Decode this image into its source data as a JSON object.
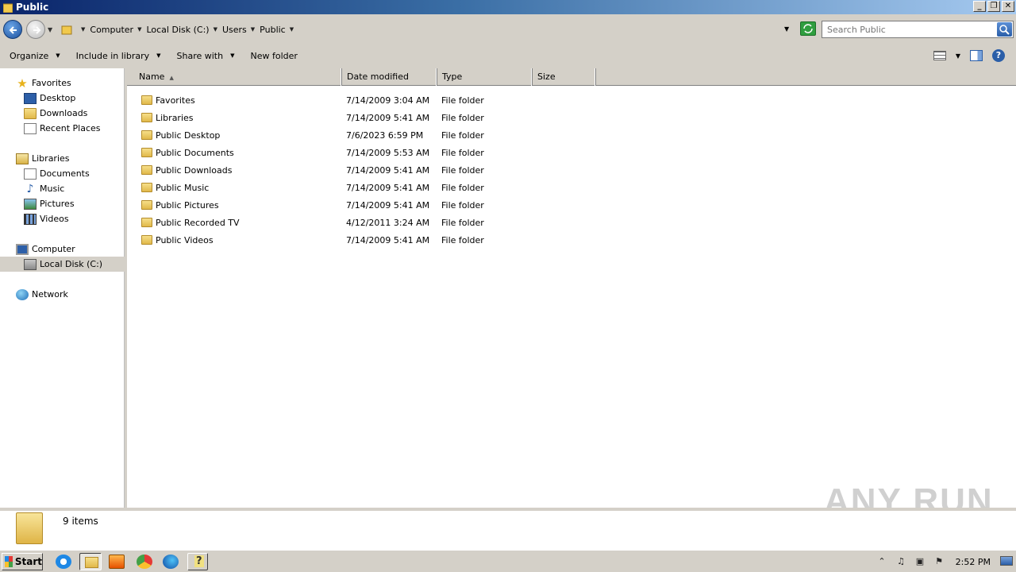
{
  "window": {
    "title": "Public"
  },
  "address": {
    "crumbs": [
      "Computer",
      "Local Disk (C:)",
      "Users",
      "Public"
    ]
  },
  "search": {
    "placeholder": "Search Public"
  },
  "toolbar": {
    "organize": "Organize",
    "include_in_library": "Include in library",
    "share_with": "Share with",
    "new_folder": "New folder"
  },
  "nav": {
    "favorites": "Favorites",
    "desktop": "Desktop",
    "downloads": "Downloads",
    "recent_places": "Recent Places",
    "libraries": "Libraries",
    "documents": "Documents",
    "music": "Music",
    "pictures": "Pictures",
    "videos": "Videos",
    "computer": "Computer",
    "local_disk": "Local Disk (C:)",
    "network": "Network"
  },
  "columns": {
    "name": "Name",
    "date_modified": "Date modified",
    "type": "Type",
    "size": "Size"
  },
  "files": [
    {
      "name": "Favorites",
      "date": "7/14/2009 3:04 AM",
      "type": "File folder"
    },
    {
      "name": "Libraries",
      "date": "7/14/2009 5:41 AM",
      "type": "File folder"
    },
    {
      "name": "Public Desktop",
      "date": "7/6/2023 6:59 PM",
      "type": "File folder"
    },
    {
      "name": "Public Documents",
      "date": "7/14/2009 5:53 AM",
      "type": "File folder"
    },
    {
      "name": "Public Downloads",
      "date": "7/14/2009 5:41 AM",
      "type": "File folder"
    },
    {
      "name": "Public Music",
      "date": "7/14/2009 5:41 AM",
      "type": "File folder"
    },
    {
      "name": "Public Pictures",
      "date": "7/14/2009 5:41 AM",
      "type": "File folder"
    },
    {
      "name": "Public Recorded TV",
      "date": "4/12/2011 3:24 AM",
      "type": "File folder"
    },
    {
      "name": "Public Videos",
      "date": "7/14/2009 5:41 AM",
      "type": "File folder"
    }
  ],
  "details": {
    "item_count": "9 items"
  },
  "watermark": "ANY RUN",
  "taskbar": {
    "start": "Start",
    "clock": "2:52 PM"
  },
  "colors": {
    "titlebar_start": "#0a246a",
    "titlebar_end": "#a6caf0",
    "chrome": "#d4d0c8"
  }
}
